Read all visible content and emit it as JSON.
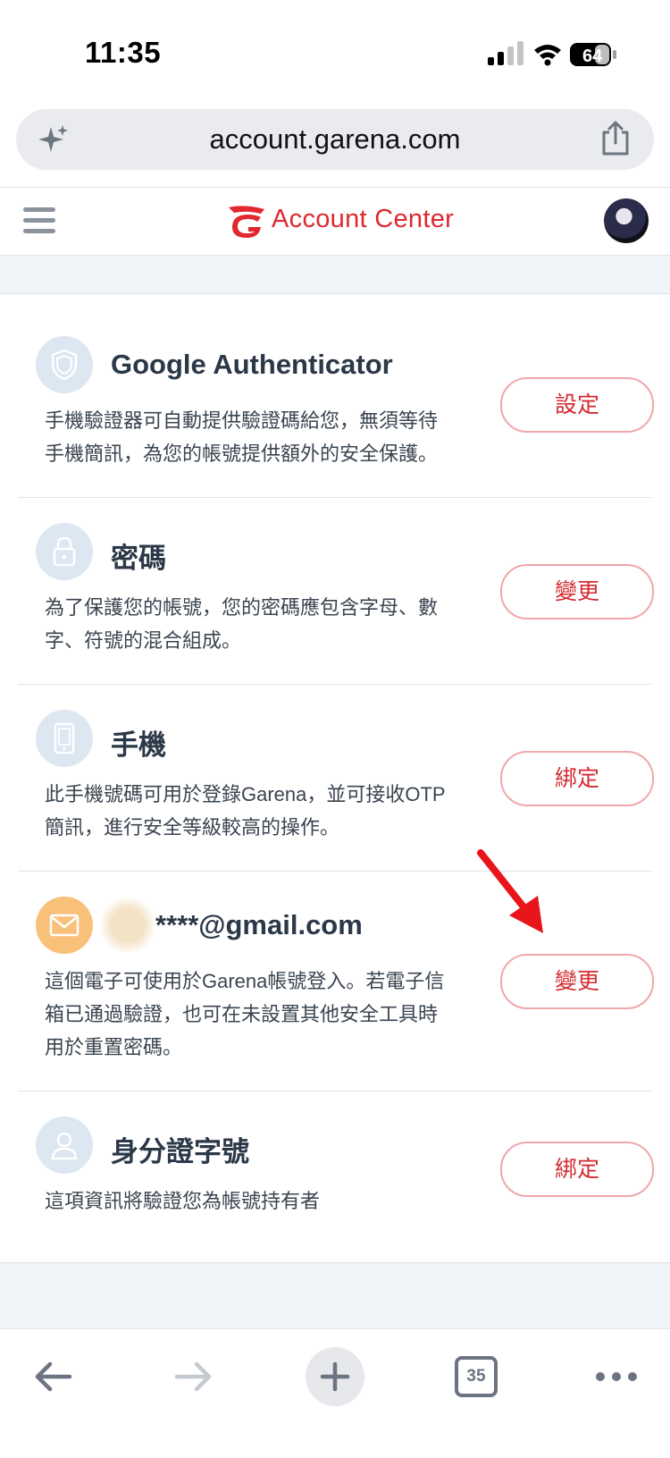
{
  "status_bar": {
    "time": "11:35",
    "battery": "64"
  },
  "browser": {
    "url": "account.garena.com",
    "tab_count": "35"
  },
  "header": {
    "brand": "Account Center"
  },
  "rows": [
    {
      "title": "Google Authenticator",
      "desc_lines": [
        "手機驗證器可自動提供驗證碼給您，無須等待",
        "手機簡訊，為您的帳號提供額外的安全保護。"
      ],
      "button": "設定",
      "icon": "shield-icon"
    },
    {
      "title": "密碼",
      "desc_lines": [
        "為了保護您的帳號，您的密碼應包含字母、數",
        "字、符號的混合組成。"
      ],
      "button": "變更",
      "icon": "lock-icon"
    },
    {
      "title": "手機",
      "desc_lines": [
        "此手機號碼可用於登錄Garena，並可接收OTP",
        "簡訊，進行安全等級較高的操作。"
      ],
      "button": "綁定",
      "icon": "phone-icon"
    },
    {
      "title": "****@gmail.com",
      "desc_lines": [
        "這個電子可使用於Garena帳號登入。若電子信",
        "箱已通過驗證，也可在未設置其他安全工具時",
        "用於重置密碼。"
      ],
      "button": "變更",
      "icon": "mail-icon"
    },
    {
      "title": "身分證字號",
      "desc_lines": [
        "這項資訊將驗證您為帳號持有者"
      ],
      "button": "綁定",
      "icon": "id-person-icon"
    }
  ],
  "colors": {
    "accent": "#d42a31",
    "button_border": "#f0a7ac",
    "icon_bg": "#dce7f2",
    "mail_icon_bg": "#f9c07a",
    "arrow": "#e8151b"
  }
}
